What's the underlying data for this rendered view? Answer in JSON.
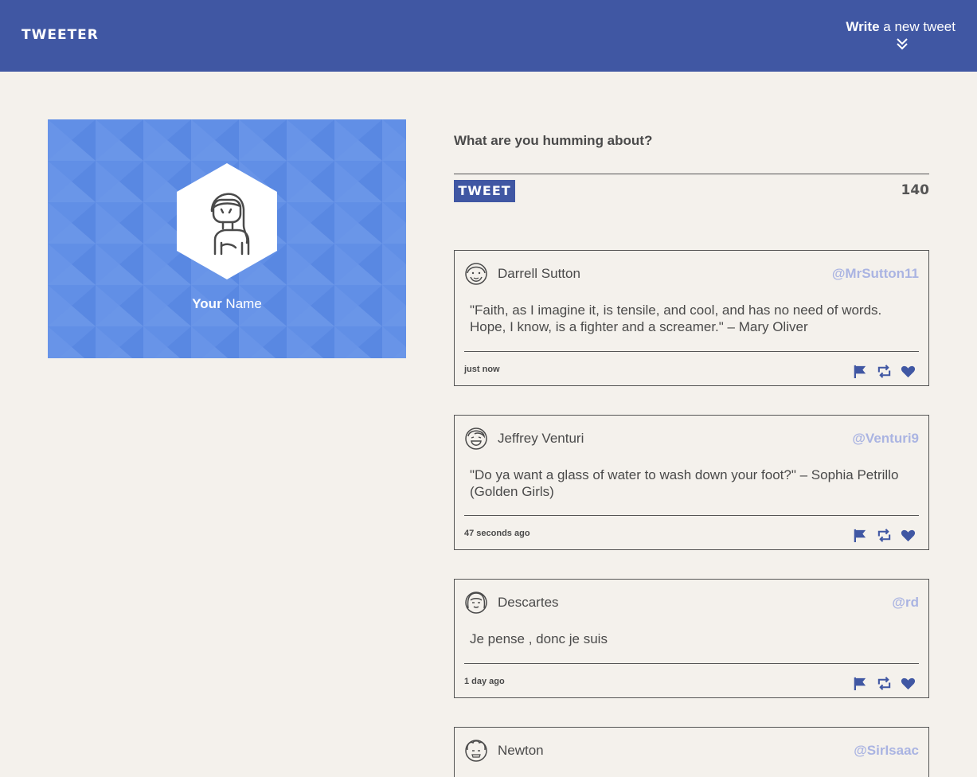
{
  "header": {
    "logo": "TWEETER",
    "compose_strong": "Write",
    "compose_rest": "a new tweet",
    "chevron_icon": "double-chevron-down-icon",
    "bg_color": "#4057a3"
  },
  "profile": {
    "name_strong": "Your",
    "name_rest": "Name",
    "avatar_icon": "woman-avatar-icon",
    "bg_color": "#5e8de6"
  },
  "composer": {
    "prompt": "What are you humming about?",
    "button_label": "TWEET",
    "char_count": "140"
  },
  "tweets": [
    {
      "name": "Darrell Sutton",
      "handle": "@MrSutton11",
      "text": "\"Faith, as I imagine it, is tensile, and cool, and has no need of words. Hope, I know, is a fighter and a screamer.\" – Mary Oliver",
      "time": "just now",
      "avatar_icon": "bearded-man-avatar-icon"
    },
    {
      "name": "Jeffrey Venturi",
      "handle": "@Venturi9",
      "text": "\"Do ya want a glass of water to wash down your foot?\" – Sophia Petrillo (Golden Girls)",
      "time": "47 seconds ago",
      "avatar_icon": "laughing-man-avatar-icon"
    },
    {
      "name": "Descartes",
      "handle": "@rd",
      "text": "Je pense , donc je suis",
      "time": "1 day ago",
      "avatar_icon": "long-hair-avatar-icon"
    },
    {
      "name": "Newton",
      "handle": "@SirIsaac",
      "avatar_icon": "curly-hair-avatar-icon"
    }
  ],
  "actions": {
    "flag_icon": "flag-icon",
    "retweet_icon": "retweet-icon",
    "like_icon": "heart-icon",
    "accent_color": "#4057a3",
    "handle_color": "#aab4e2"
  }
}
